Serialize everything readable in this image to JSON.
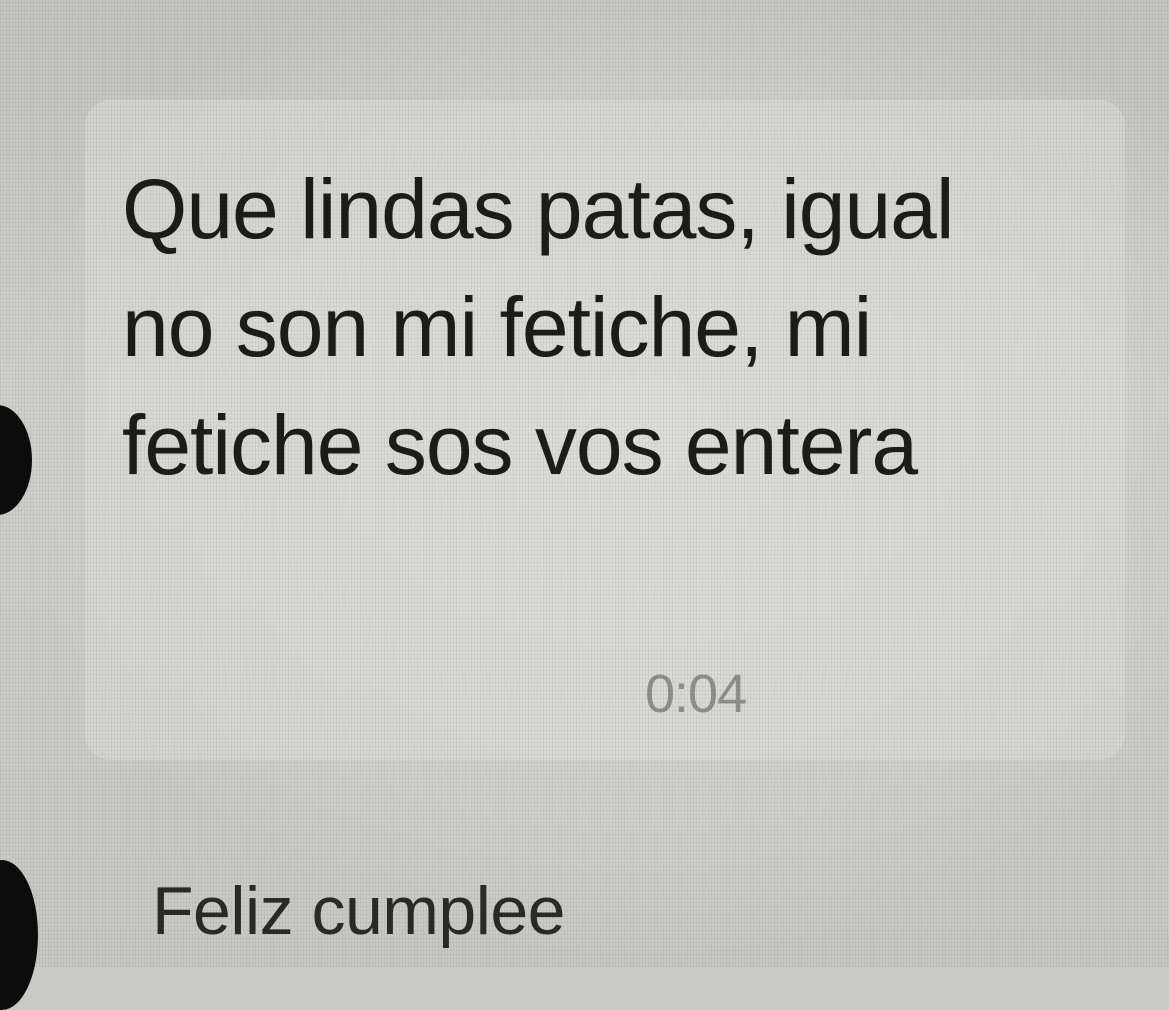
{
  "chat": {
    "messages": [
      {
        "text": "Que lindas patas, igual\nno son mi fetiche, mi\nfetiche sos vos entera",
        "time": "0:04"
      },
      {
        "text": "Feliz cumplee"
      }
    ]
  }
}
